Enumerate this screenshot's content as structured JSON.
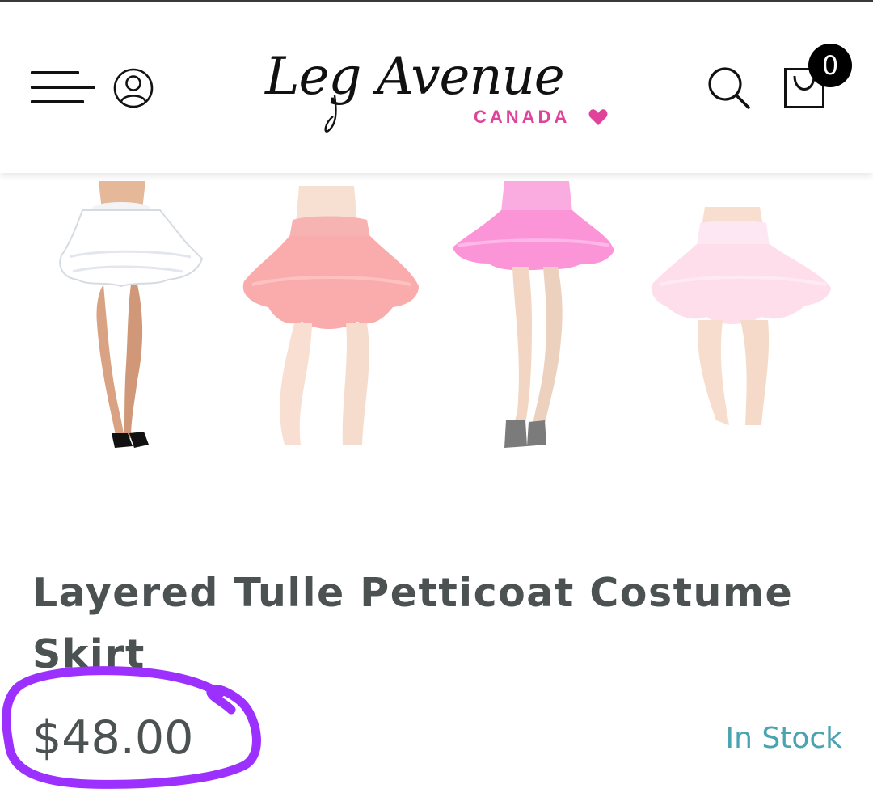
{
  "header": {
    "logo_text": "Leg Avenue",
    "logo_subtext": "CANADA",
    "cart_count": "0",
    "icons": [
      "menu-icon",
      "account-icon",
      "search-icon",
      "cart-icon"
    ]
  },
  "product": {
    "title": "Layered Tulle Petticoat Costume Skirt",
    "price": "$48.00",
    "stock_status": "In Stock",
    "thumbnail_colors": [
      "white",
      "red",
      "hot-pink",
      "light-pink"
    ]
  },
  "colors": {
    "brand_pink": "#e0449a",
    "stock_teal": "#4aa3b0",
    "annotation_purple": "#9b30ff",
    "text_gray": "#4c5252"
  }
}
